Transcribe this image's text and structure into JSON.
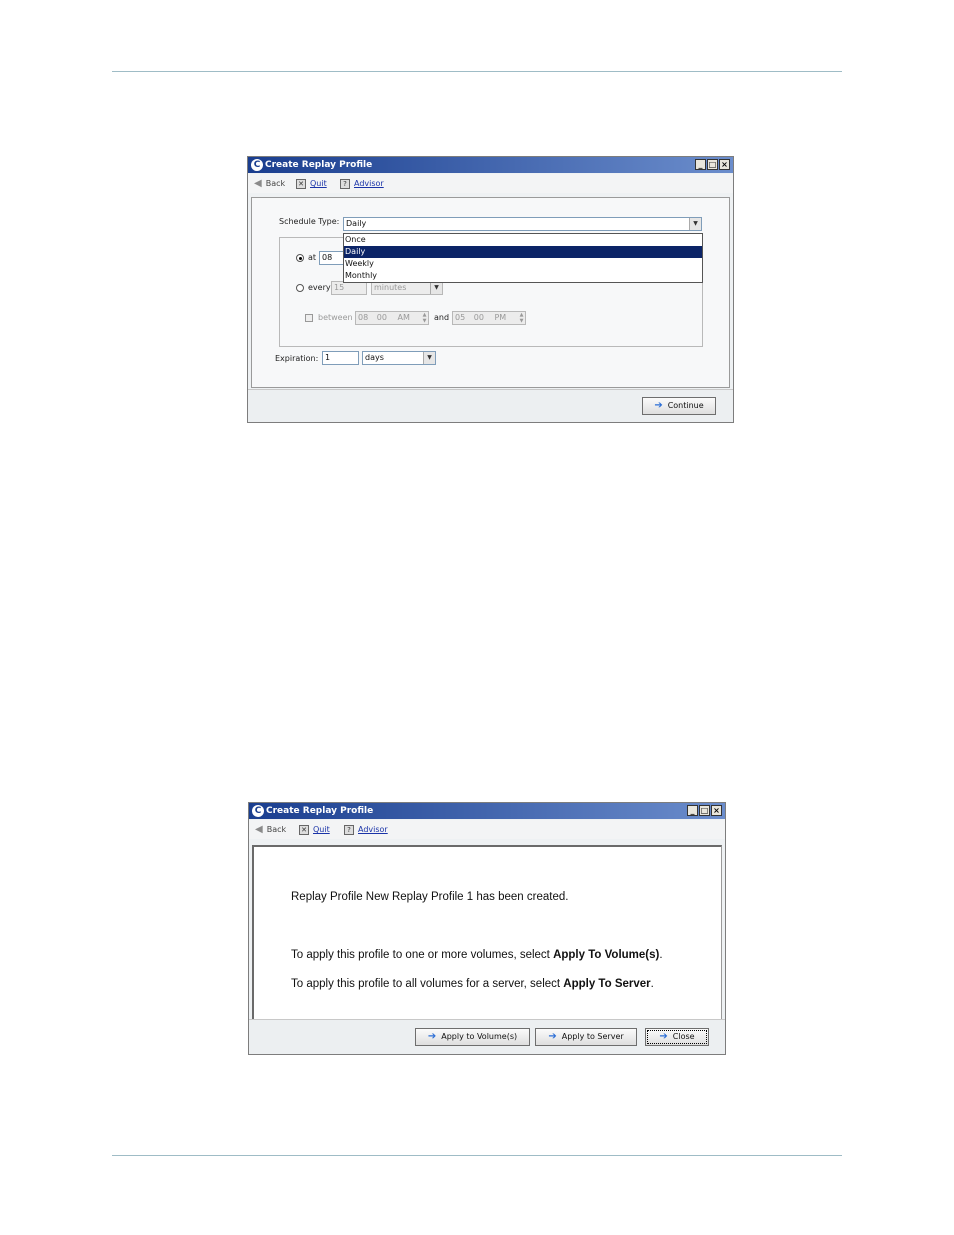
{
  "dialog1": {
    "title": "Create Replay Profile",
    "toolbar": {
      "back": "Back",
      "quit": "Quit",
      "advisor": "Advisor"
    },
    "schedule_type_label": "Schedule Type:",
    "schedule_type_value": "Daily",
    "schedule_options": [
      "Once",
      "Daily",
      "Weekly",
      "Monthly"
    ],
    "schedule_selected": "Daily",
    "at_label": "at",
    "at_hour": "08",
    "every_label": "every",
    "every_value": "15",
    "every_unit": "minutes",
    "between_label": "between",
    "between_start": {
      "hour": "08",
      "minute": "00",
      "ampm": "AM"
    },
    "and_label": "and",
    "between_end": {
      "hour": "05",
      "minute": "00",
      "ampm": "PM"
    },
    "expiration_label": "Expiration:",
    "expiration_value": "1",
    "expiration_unit": "days",
    "continue_label": "Continue"
  },
  "dialog2": {
    "title": "Create Replay Profile",
    "toolbar": {
      "back": "Back",
      "quit": "Quit",
      "advisor": "Advisor"
    },
    "created_message": "Replay Profile New Replay Profile 1 has been created.",
    "volumes_prefix": "To apply this profile to one or more volumes, select ",
    "volumes_bold": "Apply To Volume(s)",
    "volumes_suffix": ".",
    "server_prefix": "To apply this profile to all volumes for a server, select ",
    "server_bold": "Apply To Server",
    "server_suffix": ".",
    "apply_volumes_label": "Apply to Volume(s)",
    "apply_server_label": "Apply to Server",
    "close_label": "Close"
  }
}
